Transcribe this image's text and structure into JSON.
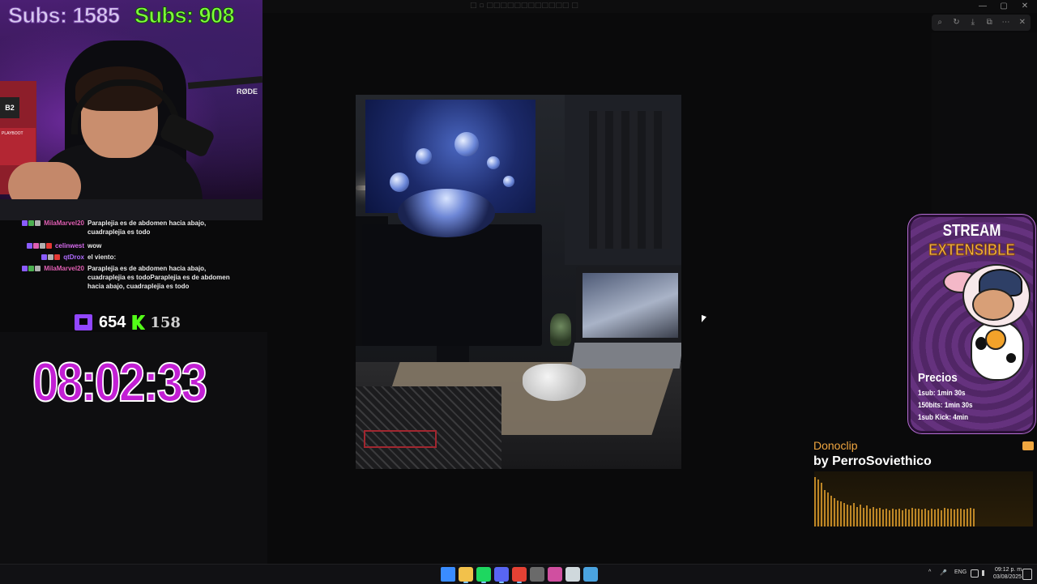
{
  "window": {
    "title": "□ ▫ □□□□□□□□□□□□ □",
    "controls": [
      "—",
      "▢",
      "✕"
    ]
  },
  "viewer_toolbar": {
    "icons": [
      "zoom-icon",
      "rotate-icon",
      "download-icon",
      "open-external-icon",
      "more-icon",
      "close-icon"
    ],
    "glyphs": [
      "⌕",
      "↻",
      "⤓",
      "⧉",
      "⋯",
      "✕"
    ]
  },
  "overlay": {
    "subs_left": "Subs: 1585",
    "subs_right": "Subs: 908",
    "mic_brand": "RØDE",
    "shelf_box_1": "B2",
    "shelf_box_2": "PLAYBOOT",
    "twitch_viewers": "654",
    "kick_viewers": "158",
    "timer": "08:02:33"
  },
  "chat": [
    {
      "user": "MilaMarvel20",
      "color": "#e05fb3",
      "badges": [
        "#8a5cff",
        "#4caf50",
        "#b0b0b0"
      ],
      "message": "Paraplejia es de abdomen hacia abajo, cuadraplejia es todo",
      "partial": true
    },
    {
      "user": "celinwest",
      "color": "#d86cf0",
      "badges": [
        "#8a5cff",
        "#e05fb3",
        "#b0b0b0",
        "#e53935"
      ],
      "message": "wow"
    },
    {
      "user": "qtDrox",
      "color": "#b06cff",
      "badges": [
        "#8a5cff",
        "#b0b0b0",
        "#e53935"
      ],
      "message": "el viento:"
    },
    {
      "user": "MilaMarvel20",
      "color": "#e05fb3",
      "badges": [
        "#8a5cff",
        "#4caf50",
        "#b0b0b0"
      ],
      "message": "Paraplejia es de abdomen hacia abajo, cuadraplejia es todoParaplejia es de abdomen hacia abajo, cuadraplejia es todo"
    }
  ],
  "promo": {
    "title_1": "STREAM",
    "title_2": "EXTENSIBLE",
    "prices_title": "Precios",
    "prices": [
      "1sub: 1min 30s",
      "150bits: 1min 30s",
      "1sub Kick: 4min"
    ]
  },
  "donoclip": {
    "title": "Donoclip",
    "by": "by PerroSoviethico",
    "wave_levels": [
      0.95,
      0.9,
      0.85,
      0.7,
      0.65,
      0.6,
      0.55,
      0.5,
      0.48,
      0.45,
      0.42,
      0.4,
      0.45,
      0.38,
      0.42,
      0.36,
      0.4,
      0.35,
      0.38,
      0.34,
      0.36,
      0.33,
      0.35,
      0.32,
      0.34,
      0.33,
      0.35,
      0.32,
      0.34,
      0.33,
      0.36,
      0.34,
      0.35,
      0.33,
      0.34,
      0.32,
      0.35,
      0.33,
      0.34,
      0.32,
      0.36,
      0.34,
      0.35,
      0.33,
      0.34,
      0.35,
      0.33,
      0.34,
      0.36,
      0.35
    ]
  },
  "taskbar": {
    "apps": [
      {
        "name": "start-icon",
        "color": "#3a8cff"
      },
      {
        "name": "file-explorer-icon",
        "color": "#f2c14b"
      },
      {
        "name": "spotify-icon",
        "color": "#1ed760"
      },
      {
        "name": "discord-icon",
        "color": "#5865f2"
      },
      {
        "name": "chrome-icon",
        "color": "#e44134"
      },
      {
        "name": "app-icon",
        "color": "#6a6a6a"
      },
      {
        "name": "app-icon-2",
        "color": "#d04fa0"
      },
      {
        "name": "steam-alt-icon",
        "color": "#cfd8dc"
      },
      {
        "name": "steam-icon",
        "color": "#4aa3df"
      }
    ],
    "tray": [
      "^",
      "🎤",
      "ENG"
    ],
    "time": "09:12 p. m.",
    "date": "03/08/2025"
  }
}
